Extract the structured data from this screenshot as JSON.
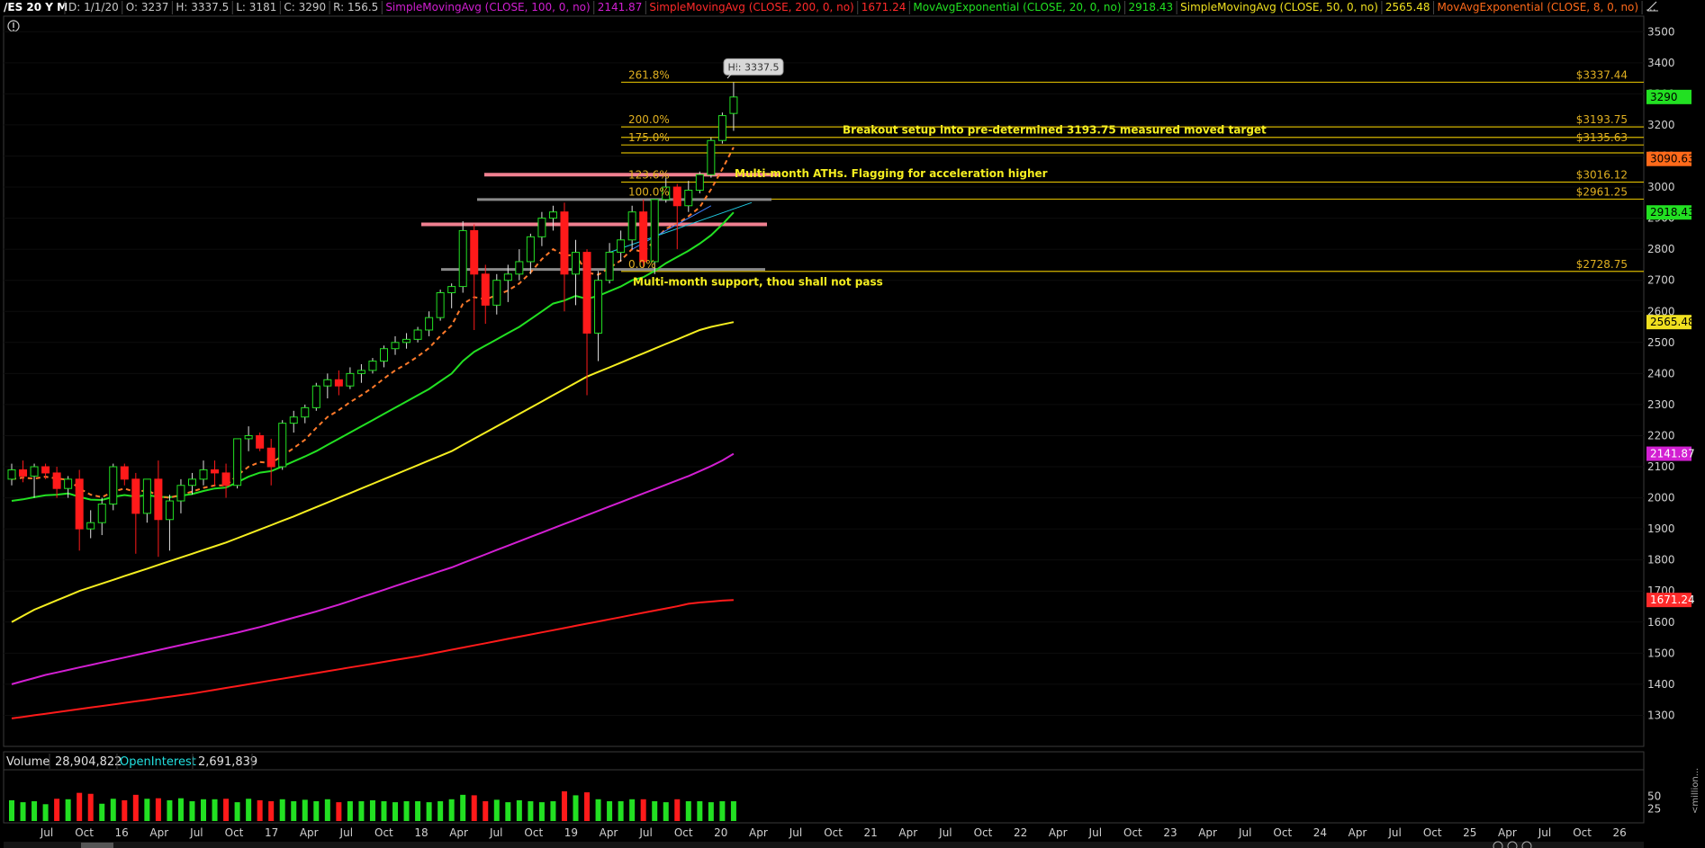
{
  "header": {
    "symbol": "/ES 20 Y M",
    "items": [
      {
        "text": "D: 1/1/20",
        "color": "#c8c8c8"
      },
      {
        "text": "O: 3237",
        "color": "#c8c8c8"
      },
      {
        "text": "H: 3337.5",
        "color": "#c8c8c8"
      },
      {
        "text": "L: 3181",
        "color": "#c8c8c8"
      },
      {
        "text": "C: 3290",
        "color": "#c8c8c8"
      },
      {
        "text": "R: 156.5",
        "color": "#c8c8c8"
      },
      {
        "text": "SimpleMovingAvg (CLOSE, 100, 0, no)",
        "color": "#d21fd2"
      },
      {
        "text": "2141.87",
        "color": "#d21fd2"
      },
      {
        "text": "SimpleMovingAvg (CLOSE, 200, 0, no)",
        "color": "#ff2a2a"
      },
      {
        "text": "1671.24",
        "color": "#ff2a2a"
      },
      {
        "text": "MovAvgExponential (CLOSE, 20, 0, no)",
        "color": "#22e022"
      },
      {
        "text": "2918.43",
        "color": "#22e022"
      },
      {
        "text": "SimpleMovingAvg (CLOSE, 50, 0, no)",
        "color": "#f0e020"
      },
      {
        "text": "2565.48",
        "color": "#f0e020"
      },
      {
        "text": "MovAvgExponential (CLOSE, 8, 0, no)",
        "color": "#ff6a1a"
      },
      {
        "text": "...",
        "color": "#c8c8c8"
      }
    ]
  },
  "chart_data": {
    "type": "candlestick",
    "y_axis": {
      "min": 1200,
      "max": 3550,
      "ticks": [
        1300,
        1400,
        1500,
        1600,
        1700,
        1800,
        1900,
        2000,
        2100,
        2200,
        2300,
        2400,
        2500,
        2600,
        2700,
        2800,
        2900,
        3000,
        3100,
        3200,
        3300,
        3400,
        3500
      ]
    },
    "x_tick_labels": [
      "Jul",
      "Oct",
      "16",
      "Apr",
      "Jul",
      "Oct",
      "17",
      "Apr",
      "Jul",
      "Oct",
      "18",
      "Apr",
      "Jul",
      "Oct",
      "19",
      "Apr",
      "Jul",
      "Oct",
      "20",
      "Apr",
      "Jul",
      "Oct",
      "21",
      "Apr",
      "Jul",
      "Oct",
      "22",
      "Apr",
      "Jul",
      "Oct",
      "23",
      "Apr",
      "Jul",
      "Oct",
      "24",
      "Apr",
      "Jul",
      "Oct",
      "25",
      "Apr",
      "Jul",
      "Oct",
      "26"
    ],
    "candles": [
      [
        2060,
        2110,
        2040,
        2090
      ],
      [
        2090,
        2120,
        2050,
        2070
      ],
      [
        2070,
        2110,
        2000,
        2100
      ],
      [
        2100,
        2110,
        2060,
        2080
      ],
      [
        2080,
        2100,
        2000,
        2030
      ],
      [
        2030,
        2070,
        2000,
        2060
      ],
      [
        2060,
        2090,
        1830,
        1900
      ],
      [
        1900,
        1960,
        1870,
        1920
      ],
      [
        1920,
        2000,
        1880,
        1980
      ],
      [
        1980,
        2110,
        1960,
        2100
      ],
      [
        2100,
        2110,
        2040,
        2060
      ],
      [
        2060,
        2080,
        1820,
        1950
      ],
      [
        1950,
        2050,
        1920,
        2060
      ],
      [
        2060,
        2120,
        1810,
        1930
      ],
      [
        1930,
        2010,
        1830,
        1990
      ],
      [
        1990,
        2060,
        1950,
        2040
      ],
      [
        2040,
        2080,
        2010,
        2060
      ],
      [
        2060,
        2120,
        2040,
        2090
      ],
      [
        2090,
        2120,
        2040,
        2080
      ],
      [
        2080,
        2110,
        2000,
        2040
      ],
      [
        2040,
        2190,
        2030,
        2190
      ],
      [
        2190,
        2230,
        2150,
        2200
      ],
      [
        2200,
        2210,
        2150,
        2160
      ],
      [
        2160,
        2190,
        2040,
        2100
      ],
      [
        2100,
        2250,
        2090,
        2240
      ],
      [
        2240,
        2280,
        2210,
        2260
      ],
      [
        2260,
        2300,
        2240,
        2290
      ],
      [
        2290,
        2370,
        2280,
        2360
      ],
      [
        2360,
        2400,
        2320,
        2380
      ],
      [
        2380,
        2410,
        2330,
        2360
      ],
      [
        2360,
        2420,
        2350,
        2400
      ],
      [
        2400,
        2430,
        2370,
        2410
      ],
      [
        2410,
        2450,
        2400,
        2440
      ],
      [
        2440,
        2490,
        2420,
        2480
      ],
      [
        2480,
        2520,
        2460,
        2500
      ],
      [
        2500,
        2530,
        2480,
        2510
      ],
      [
        2510,
        2550,
        2500,
        2540
      ],
      [
        2540,
        2600,
        2520,
        2580
      ],
      [
        2580,
        2670,
        2570,
        2660
      ],
      [
        2660,
        2690,
        2610,
        2680
      ],
      [
        2680,
        2890,
        2660,
        2860
      ],
      [
        2860,
        2880,
        2540,
        2720
      ],
      [
        2720,
        2750,
        2560,
        2620
      ],
      [
        2620,
        2720,
        2590,
        2700
      ],
      [
        2700,
        2750,
        2630,
        2720
      ],
      [
        2720,
        2800,
        2700,
        2760
      ],
      [
        2760,
        2850,
        2720,
        2840
      ],
      [
        2840,
        2920,
        2810,
        2900
      ],
      [
        2900,
        2940,
        2860,
        2920
      ],
      [
        2920,
        2950,
        2600,
        2720
      ],
      [
        2720,
        2830,
        2620,
        2790
      ],
      [
        2790,
        2800,
        2330,
        2530
      ],
      [
        2530,
        2730,
        2440,
        2700
      ],
      [
        2700,
        2820,
        2690,
        2790
      ],
      [
        2790,
        2860,
        2760,
        2830
      ],
      [
        2830,
        2940,
        2800,
        2920
      ],
      [
        2920,
        2960,
        2740,
        2760
      ],
      [
        2760,
        2960,
        2720,
        2960
      ],
      [
        2960,
        3030,
        2950,
        3000
      ],
      [
        3000,
        3010,
        2800,
        2940
      ],
      [
        2940,
        3020,
        2920,
        2990
      ],
      [
        2990,
        3050,
        2980,
        3040
      ],
      [
        3040,
        3160,
        3030,
        3150
      ],
      [
        3150,
        3240,
        3140,
        3230
      ],
      [
        3237,
        3337.5,
        3181,
        3290
      ]
    ],
    "ema8": [
      2060,
      2065,
      2062,
      2068,
      2062,
      2058,
      2030,
      2010,
      2002,
      2020,
      2030,
      2018,
      2025,
      2005,
      2000,
      2010,
      2020,
      2032,
      2040,
      2040,
      2072,
      2100,
      2115,
      2112,
      2135,
      2160,
      2187,
      2225,
      2260,
      2282,
      2308,
      2330,
      2355,
      2384,
      2410,
      2431,
      2455,
      2482,
      2521,
      2555,
      2624,
      2646,
      2639,
      2652,
      2667,
      2690,
      2725,
      2768,
      2800,
      2780,
      2782,
      2725,
      2718,
      2740,
      2764,
      2800,
      2791,
      2828,
      2866,
      2882,
      2906,
      2935,
      2993,
      3058,
      3128
    ],
    "ema20": [
      1990,
      1995,
      2002,
      2008,
      2010,
      2014,
      2003,
      1994,
      1993,
      2003,
      2009,
      2004,
      2009,
      2003,
      2002,
      2007,
      2012,
      2022,
      2030,
      2033,
      2050,
      2068,
      2081,
      2086,
      2101,
      2117,
      2133,
      2150,
      2170,
      2190,
      2210,
      2230,
      2250,
      2270,
      2290,
      2310,
      2330,
      2350,
      2375,
      2400,
      2440,
      2470,
      2490,
      2510,
      2530,
      2550,
      2575,
      2600,
      2625,
      2635,
      2650,
      2640,
      2650,
      2665,
      2680,
      2700,
      2710,
      2730,
      2755,
      2775,
      2795,
      2818,
      2845,
      2880,
      2918.43
    ],
    "sma50": [
      1600,
      1620,
      1640,
      1655,
      1670,
      1685,
      1700,
      1712,
      1724,
      1736,
      1748,
      1760,
      1772,
      1784,
      1796,
      1808,
      1820,
      1832,
      1844,
      1856,
      1870,
      1884,
      1898,
      1912,
      1926,
      1940,
      1955,
      1970,
      1985,
      2000,
      2015,
      2030,
      2045,
      2060,
      2075,
      2090,
      2105,
      2120,
      2135,
      2150,
      2170,
      2190,
      2210,
      2230,
      2250,
      2270,
      2290,
      2310,
      2330,
      2350,
      2370,
      2390,
      2405,
      2420,
      2435,
      2450,
      2465,
      2480,
      2495,
      2510,
      2525,
      2540,
      2550,
      2558,
      2565.48
    ],
    "sma100": [
      1400,
      1410,
      1420,
      1430,
      1438,
      1446,
      1454,
      1462,
      1470,
      1478,
      1486,
      1494,
      1502,
      1510,
      1518,
      1526,
      1534,
      1542,
      1550,
      1558,
      1566,
      1575,
      1584,
      1594,
      1604,
      1614,
      1624,
      1634,
      1645,
      1656,
      1668,
      1680,
      1692,
      1704,
      1716,
      1728,
      1740,
      1752,
      1764,
      1776,
      1790,
      1804,
      1818,
      1832,
      1846,
      1860,
      1874,
      1888,
      1902,
      1916,
      1930,
      1944,
      1958,
      1972,
      1986,
      2000,
      2014,
      2028,
      2042,
      2056,
      2070,
      2086,
      2102,
      2120,
      2141.87
    ],
    "sma200": [
      1290,
      1295,
      1300,
      1305,
      1310,
      1315,
      1320,
      1325,
      1330,
      1335,
      1340,
      1345,
      1350,
      1355,
      1360,
      1365,
      1370,
      1376,
      1382,
      1388,
      1394,
      1400,
      1406,
      1412,
      1418,
      1424,
      1430,
      1436,
      1442,
      1448,
      1454,
      1460,
      1466,
      1472,
      1478,
      1484,
      1490,
      1497,
      1504,
      1511,
      1518,
      1525,
      1532,
      1539,
      1546,
      1553,
      1560,
      1567,
      1574,
      1581,
      1588,
      1595,
      1602,
      1609,
      1616,
      1623,
      1630,
      1637,
      1644,
      1651,
      1659,
      1663,
      1666,
      1669,
      1671.24
    ],
    "fib_levels": [
      {
        "label": "261.8%",
        "value": 3337.44,
        "price": "$3337.44"
      },
      {
        "label": "200.0%",
        "value": 3193.75,
        "price": "$3193.75"
      },
      {
        "label": "175.0%",
        "value": 3135.63,
        "price": "$3135.63"
      },
      {
        "label": "123.6%",
        "value": 3016.12,
        "price": "$3016.12"
      },
      {
        "label": "100.0%",
        "value": 2961.25,
        "price": "$2961.25"
      },
      {
        "label": "0.0%",
        "value": 2728.75,
        "price": "$2728.75"
      }
    ],
    "extra_levels": [
      3160,
      3110
    ],
    "pink_lines": [
      3040,
      2880
    ],
    "gray_lines": [
      2960,
      2735
    ],
    "annotations": [
      {
        "text": "Breakout setup  into pre-determined 3193.75 measured moved target",
        "value": 3190
      },
      {
        "text": "Multi-month ATHs. Flagging for acceleration higher",
        "value": 3050
      },
      {
        "text": "Multi-month support, thou shall not pass",
        "value": 2700
      }
    ],
    "hi_label": "Hi: 3337.5",
    "price_tags": [
      {
        "text": "3290",
        "value": 3290,
        "bg": "#22e022",
        "fg": "#000"
      },
      {
        "text": "3090.63",
        "value": 3090.63,
        "bg": "#ff6a1a",
        "fg": "#000"
      },
      {
        "text": "2918.43",
        "value": 2918.43,
        "bg": "#22e022",
        "fg": "#000"
      },
      {
        "text": "2565.48",
        "value": 2565.48,
        "bg": "#f0e020",
        "fg": "#000"
      },
      {
        "text": "2141.87",
        "value": 2141.87,
        "bg": "#d21fd2",
        "fg": "#fff"
      },
      {
        "text": "1671.24",
        "value": 1671.24,
        "bg": "#ff2a2a",
        "fg": "#fff"
      }
    ],
    "volume": [
      42,
      38,
      40,
      34,
      45,
      44,
      57,
      55,
      35,
      45,
      42,
      53,
      45,
      46,
      42,
      46,
      40,
      44,
      44,
      45,
      38,
      45,
      42,
      40,
      44,
      40,
      43,
      40,
      44,
      38,
      40,
      40,
      42,
      40,
      38,
      40,
      40,
      38,
      40,
      44,
      53,
      52,
      40,
      43,
      38,
      42,
      40,
      38,
      40,
      60,
      52,
      58,
      44,
      40,
      40,
      44,
      44,
      40,
      38,
      44,
      40,
      40,
      38,
      40,
      40
    ],
    "volume_colors": [
      "g",
      "g",
      "g",
      "g",
      "r",
      "g",
      "r",
      "r",
      "g",
      "g",
      "r",
      "r",
      "g",
      "r",
      "g",
      "g",
      "g",
      "g",
      "g",
      "r",
      "g",
      "g",
      "r",
      "r",
      "g",
      "g",
      "g",
      "g",
      "g",
      "r",
      "g",
      "g",
      "g",
      "g",
      "g",
      "g",
      "g",
      "g",
      "g",
      "g",
      "g",
      "r",
      "r",
      "g",
      "g",
      "g",
      "g",
      "g",
      "g",
      "r",
      "g",
      "r",
      "g",
      "g",
      "g",
      "g",
      "r",
      "g",
      "g",
      "r",
      "g",
      "g",
      "g",
      "g",
      "g"
    ],
    "volume_ticks": [
      50,
      25
    ]
  },
  "volume_panel": {
    "label": "Volume",
    "value": "28,904,822",
    "oi_label": "OpenInterest",
    "oi_value": "2,691,839",
    "unit": "<million..."
  }
}
